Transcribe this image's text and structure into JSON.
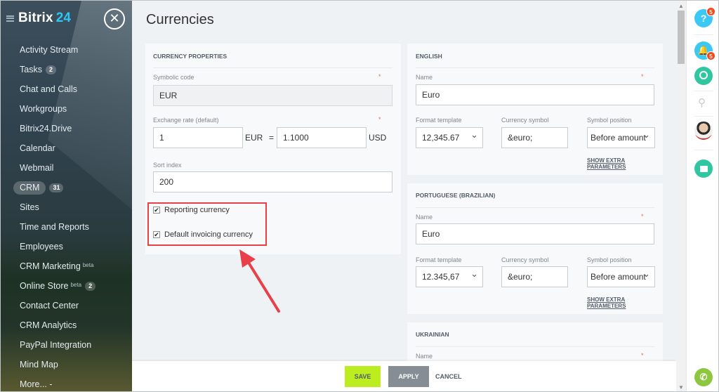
{
  "sidebar": {
    "logo": {
      "name": "Bitrix",
      "number": "24"
    },
    "items": [
      {
        "label": "Activity Stream"
      },
      {
        "label": "Tasks",
        "badge": "2"
      },
      {
        "label": "Chat and Calls"
      },
      {
        "label": "Workgroups"
      },
      {
        "label": "Bitrix24.Drive"
      },
      {
        "label": "Calendar"
      },
      {
        "label": "Webmail"
      },
      {
        "label": "CRM",
        "badge": "31"
      },
      {
        "label": "Sites"
      },
      {
        "label": "Time and Reports"
      },
      {
        "label": "Employees"
      },
      {
        "label": "CRM Marketing",
        "sup": "beta"
      },
      {
        "label": "Online Store",
        "sup": "beta",
        "badge": "2"
      },
      {
        "label": "Contact Center"
      },
      {
        "label": "CRM Analytics"
      },
      {
        "label": "PayPal Integration"
      },
      {
        "label": "Mind Map"
      },
      {
        "label": "More... -"
      }
    ]
  },
  "page": {
    "title": "Currencies"
  },
  "currency_properties": {
    "heading": "CURRENCY PROPERTIES",
    "symbolic_code_label": "Symbolic code",
    "symbolic_code_value": "EUR",
    "exchange_rate_label": "Exchange rate (default)",
    "rate_amount": "1",
    "rate_from": "EUR",
    "equals": "=",
    "rate_value": "1.1000",
    "rate_to": "USD",
    "sort_index_label": "Sort index",
    "sort_index_value": "200",
    "reporting_currency": {
      "label": "Reporting currency",
      "checked": true
    },
    "default_invoicing": {
      "label": "Default invoicing currency",
      "checked": true
    },
    "required_mark": "*"
  },
  "languages": [
    {
      "heading": "ENGLISH",
      "name_label": "Name",
      "name_value": "Euro",
      "format_label": "Format template",
      "format_value": "12,345.67",
      "symbol_label": "Currency symbol",
      "symbol_value": "&euro;",
      "position_label": "Symbol position",
      "position_value": "Before amount",
      "extra_link": "SHOW EXTRA PARAMETERS"
    },
    {
      "heading": "PORTUGUESE (BRAZILIAN)",
      "name_label": "Name",
      "name_value": "Euro",
      "format_label": "Format template",
      "format_value": "12.345,67",
      "symbol_label": "Currency symbol",
      "symbol_value": "&euro;",
      "position_label": "Symbol position",
      "position_value": "Before amount",
      "extra_link": "SHOW EXTRA PARAMETERS"
    },
    {
      "heading": "UKRAINIAN",
      "name_label": "Name"
    }
  ],
  "footer": {
    "save": "SAVE",
    "apply": "APPLY",
    "cancel": "CANCEL"
  },
  "right_bar": {
    "help_badge": "5",
    "notif_badge": "5",
    "help_icon": "?"
  },
  "colors": {
    "accent_blue": "#2fc6f6",
    "save_green": "#bbed21",
    "highlight_red": "#e8404a",
    "right_icon_teal": "#2fc6a0"
  }
}
